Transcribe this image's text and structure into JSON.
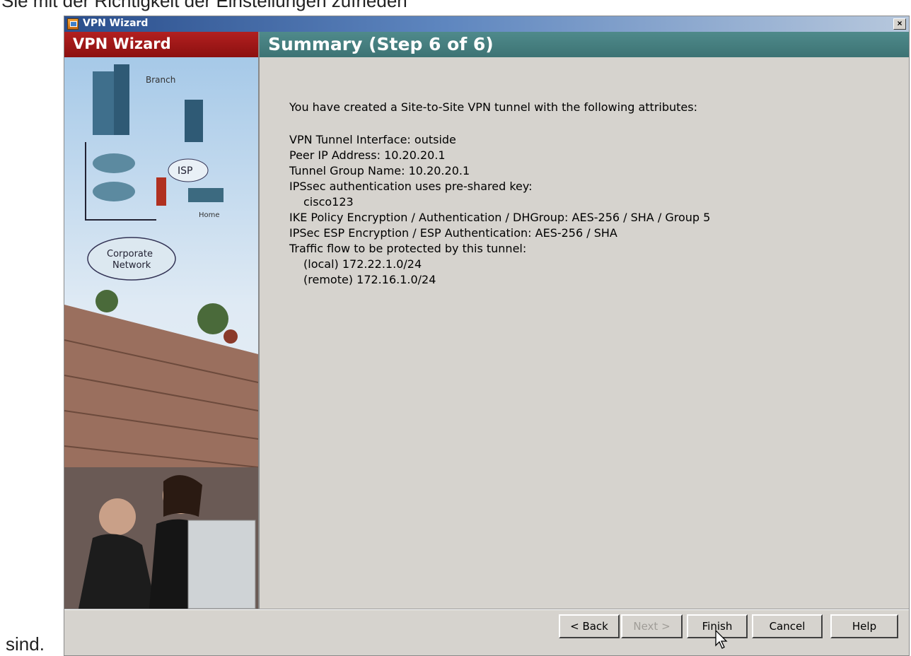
{
  "page_text": {
    "top": "Sie mit der Richtigkeit der Einstellungen zufrieden",
    "bottom": "sind."
  },
  "window": {
    "title": "VPN Wizard",
    "close": "×"
  },
  "left_panel": {
    "header": "VPN Wizard",
    "image_labels": {
      "branch": "Branch",
      "isp": "ISP",
      "home": "Home",
      "corporate": "Corporate",
      "network": "Network"
    }
  },
  "step": {
    "title": "Summary  (Step 6 of 6)"
  },
  "summary": {
    "intro": "You have created a Site-to-Site VPN tunnel with the following attributes:",
    "interface": "VPN Tunnel Interface:  outside",
    "peer_ip": "Peer IP Address:  10.20.20.1",
    "tunnel_group": "Tunnel Group Name:  10.20.20.1",
    "ipsec_auth": "IPSsec authentication uses pre-shared key:",
    "psk": "cisco123",
    "ike_policy": "IKE Policy Encryption / Authentication / DHGroup:  AES-256 / SHA / Group 5",
    "esp": "IPSec ESP Encryption / ESP Authentication:  AES-256 / SHA",
    "traffic": "Traffic flow to be protected by this tunnel:",
    "local": "(local)  172.22.1.0/24",
    "remote": "(remote)  172.16.1.0/24"
  },
  "buttons": {
    "back": "< Back",
    "next": "Next >",
    "finish": "Finish",
    "cancel": "Cancel",
    "help": "Help"
  }
}
